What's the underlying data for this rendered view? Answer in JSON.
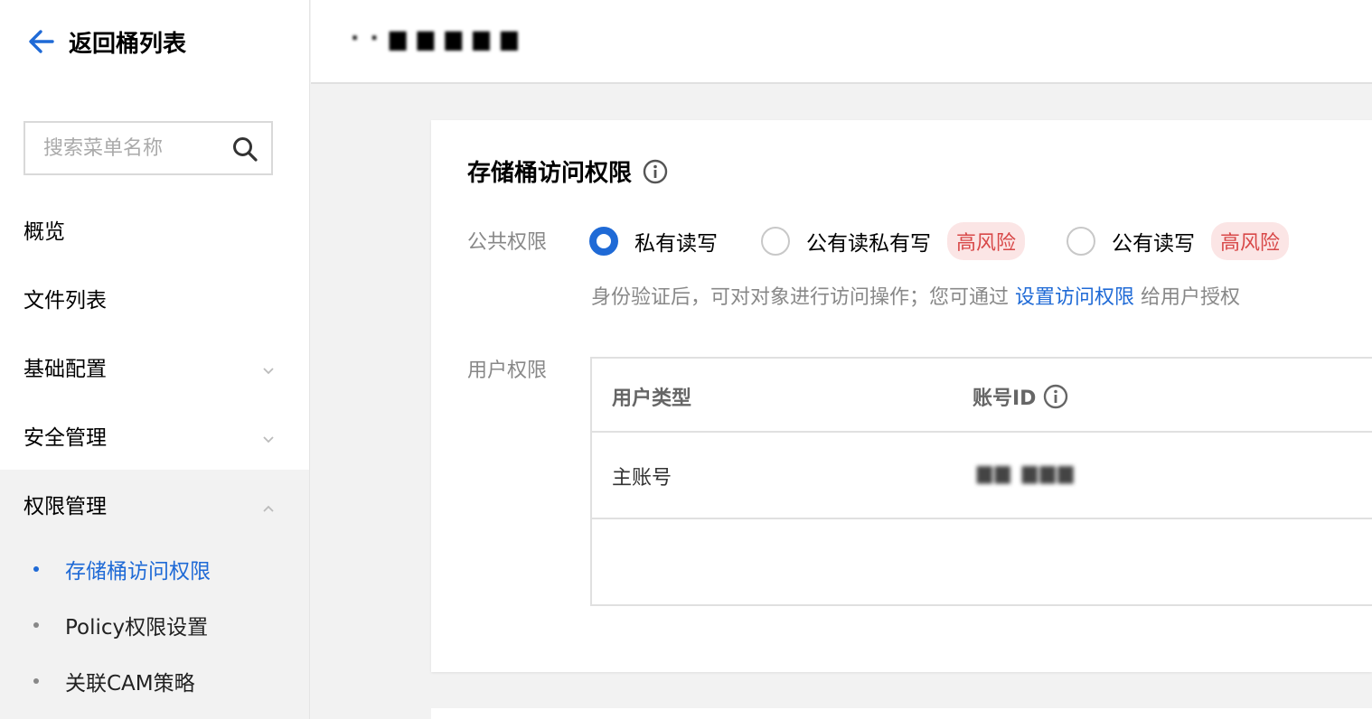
{
  "sidebar": {
    "back_label": "返回桶列表",
    "search_placeholder": "搜索菜单名称",
    "items": [
      {
        "label": "概览"
      },
      {
        "label": "文件列表"
      },
      {
        "label": "基础配置"
      },
      {
        "label": "安全管理"
      },
      {
        "label": "权限管理"
      }
    ],
    "sub_items": [
      {
        "label": "存储桶访问权限"
      },
      {
        "label": "Policy权限设置"
      },
      {
        "label": "关联CAM策略"
      }
    ]
  },
  "header": {
    "bucket_name": "· ·  ▆ ▆ ▆ ▆ ▆"
  },
  "card": {
    "title": "存储桶访问权限",
    "public_label": "公共权限",
    "options": [
      {
        "label": "私有读写",
        "checked": true
      },
      {
        "label": "公有读私有写",
        "badge": "高风险"
      },
      {
        "label": "公有读写",
        "badge": "高风险"
      }
    ],
    "help_prefix": "身份验证后，可对对象进行访问操作；您可通过",
    "help_link": "设置访问权限",
    "help_suffix": "给用户授权",
    "user_label": "用户权限",
    "table": {
      "col_user_type": "用户类型",
      "col_account_id": "账号ID",
      "rows": [
        {
          "user_type": "主账号",
          "account_id": "▆▆  ▆▆▆"
        }
      ]
    }
  },
  "colors": {
    "accent": "#1f6ad6",
    "risk_text": "#d84848",
    "risk_bg": "#fbe5e5"
  }
}
